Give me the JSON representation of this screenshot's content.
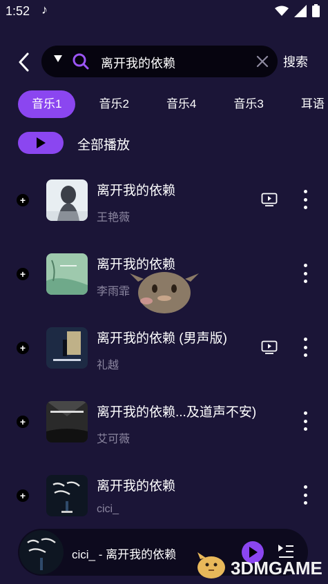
{
  "status": {
    "time": "1:52"
  },
  "search": {
    "query": "离开我的依赖",
    "submit_label": "搜索"
  },
  "tabs": [
    {
      "label": "音乐1",
      "active": true
    },
    {
      "label": "音乐2",
      "active": false
    },
    {
      "label": "音乐4",
      "active": false
    },
    {
      "label": "音乐3",
      "active": false
    },
    {
      "label": "耳语",
      "active": false
    }
  ],
  "play_all": {
    "label": "全部播放"
  },
  "songs": [
    {
      "title": "离开我的依赖",
      "artist": "王艳薇",
      "has_mv": true
    },
    {
      "title": "离开我的依赖",
      "artist": "李雨霏",
      "has_mv": false
    },
    {
      "title": "离开我的依赖 (男声版)",
      "artist": "礼越",
      "has_mv": true
    },
    {
      "title": "离开我的依赖...及道声不安)",
      "artist": "艾可薇",
      "has_mv": false
    },
    {
      "title": "离开我的依赖",
      "artist": "cici_",
      "has_mv": false
    }
  ],
  "player": {
    "now_playing": "cici_ - 离开我的依赖"
  },
  "watermark": {
    "text": "3DMGAME"
  },
  "colors": {
    "accent": "#8b46f0",
    "background": "#1b1537",
    "secondary_text": "#8c87a0"
  }
}
